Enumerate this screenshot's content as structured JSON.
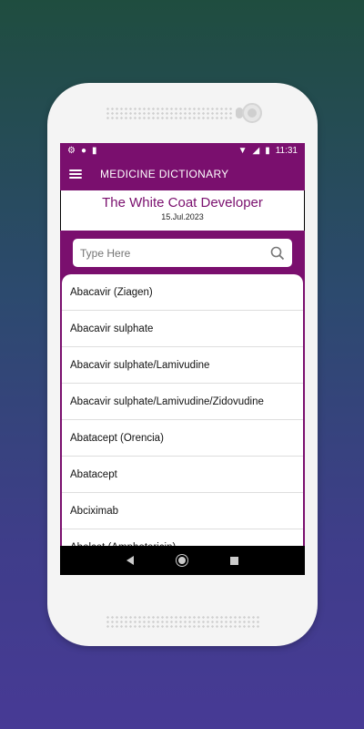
{
  "status": {
    "time": "11:31"
  },
  "appbar": {
    "title": "MEDICINE DICTIONARY"
  },
  "header": {
    "developer": "The White Coat Developer",
    "date": "15.Jul.2023"
  },
  "search": {
    "placeholder": "Type Here"
  },
  "medicines": [
    "Abacavir (Ziagen)",
    "Abacavir sulphate",
    "Abacavir sulphate/Lamivudine",
    "Abacavir sulphate/Lamivudine/Zidovudine",
    "Abatacept (Orencia)",
    "Abatacept",
    "Abciximab",
    "Abelcet (Amphotericin)"
  ],
  "colors": {
    "primary": "#7a0f6e"
  }
}
